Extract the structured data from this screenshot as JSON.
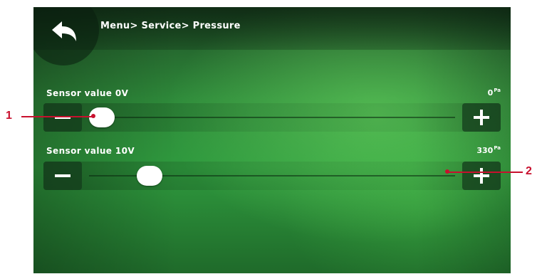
{
  "header": {
    "breadcrumb": "Menu> Service> Pressure",
    "back_icon": "back-arrow-icon"
  },
  "sliders": [
    {
      "label": "Sensor value 0V",
      "value": "0",
      "unit": "Pa",
      "min": 0,
      "max": 1000,
      "level": 0,
      "minus_icon": "minus-icon",
      "plus_icon": "plus-icon"
    },
    {
      "label": "Sensor value 10V",
      "value": "330",
      "unit": "Pa",
      "min": 0,
      "max": 1000,
      "level": 0.14,
      "minus_icon": "minus-icon",
      "plus_icon": "plus-icon"
    }
  ],
  "callouts": [
    {
      "number": "1"
    },
    {
      "number": "2"
    }
  ],
  "colors": {
    "callout": "#c8102e",
    "background": "#2e8a3a"
  }
}
